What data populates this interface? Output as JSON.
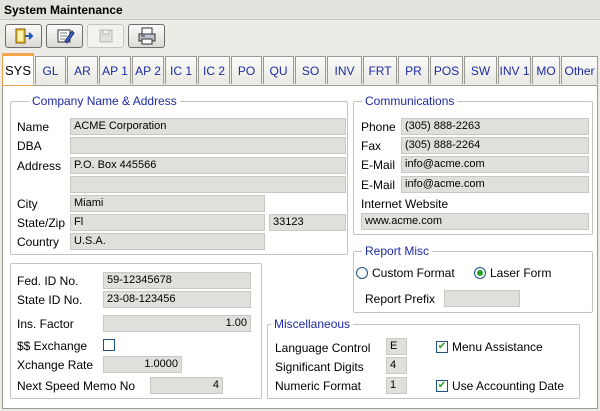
{
  "window": {
    "title": "System Maintenance"
  },
  "toolbar": {
    "buttons": [
      {
        "name": "exit-icon"
      },
      {
        "name": "edit-icon"
      },
      {
        "name": "save-icon"
      },
      {
        "name": "print-icon"
      }
    ]
  },
  "tabs": [
    "SYS",
    "GL",
    "AR",
    "AP 1",
    "AP 2",
    "IC 1",
    "IC 2",
    "PO",
    "QU",
    "SO",
    "INV",
    "FRT",
    "PR",
    "POS",
    "SW",
    "INV 1",
    "MO",
    "Other"
  ],
  "company": {
    "group_title": "Company Name & Address",
    "name_label": "Name",
    "name": "ACME Corporation",
    "dba_label": "DBA",
    "dba": "",
    "address_label": "Address",
    "address1": "P.O. Box 445566",
    "address2": "",
    "city_label": "City",
    "city": "Miami",
    "state_zip_label": "State/Zip",
    "state": "Fl",
    "zip": "33123",
    "country_label": "Country",
    "country": "U.S.A."
  },
  "communications": {
    "group_title": "Communications",
    "phone_label": "Phone",
    "phone": "(305) 888-2263",
    "fax_label": "Fax",
    "fax": "(305) 888-2264",
    "email_label": "E-Mail",
    "email1": "info@acme.com",
    "email2_label": "E-Mail",
    "email2": "info@acme.com",
    "website_label": "Internet Website",
    "website": "www.acme.com"
  },
  "report_misc": {
    "group_title": "Report Misc",
    "custom_format_label": "Custom Format",
    "laser_form_label": "Laser Form",
    "selected": "Laser Form",
    "report_prefix_label": "Report Prefix",
    "report_prefix": ""
  },
  "ids": {
    "fed_id_label": "Fed. ID No.",
    "fed_id": "59-12345678",
    "state_id_label": "State ID No.",
    "state_id": "23-08-123456",
    "ins_factor_label": "Ins. Factor",
    "ins_factor": "1.00",
    "exchange_label": "$$ Exchange",
    "exchange_checked": false,
    "xchange_rate_label": "Xchange Rate",
    "xchange_rate": "1.0000",
    "speed_memo_label": "Next Speed Memo No",
    "speed_memo": "4"
  },
  "misc": {
    "group_title": "Miscellaneous",
    "language_control_label": "Language Control",
    "language_control": "E",
    "significant_digits_label": "Significant Digits",
    "significant_digits": "4",
    "numeric_format_label": "Numeric Format",
    "numeric_format": "1",
    "menu_assistance_label": "Menu Assistance",
    "menu_assistance_checked": true,
    "use_accounting_date_label": "Use Accounting Date",
    "use_accounting_date_checked": true
  }
}
